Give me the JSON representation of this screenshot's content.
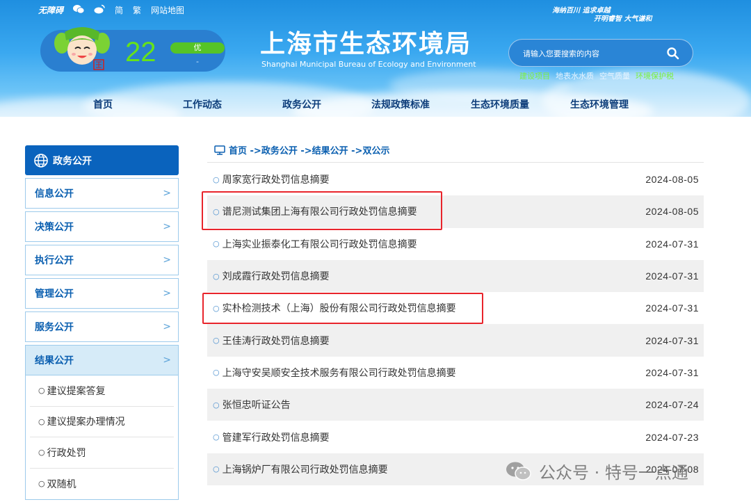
{
  "topbar": {
    "accessibility": "无障碍",
    "simplified": "简",
    "traditional": "繁",
    "sitemap": "网站地图"
  },
  "slogan": {
    "line1": "海纳百川  追求卓越",
    "line2": "开明睿智  大气谦和"
  },
  "aqi": {
    "value": "22",
    "level": "优",
    "sub": "-"
  },
  "site": {
    "title": "上海市生态环境局",
    "subtitle": "Shanghai Municipal Bureau of Ecology and Environment"
  },
  "search": {
    "placeholder": "请输入您要搜索的内容"
  },
  "quick_links": [
    "建设项目",
    "地表水水质",
    "空气质量",
    "环境保护税"
  ],
  "nav": [
    "首页",
    "工作动态",
    "政务公开",
    "法规政策标准",
    "生态环境质量",
    "生态环境管理"
  ],
  "sidebar": {
    "header": "政务公开",
    "items": [
      "信息公开",
      "决策公开",
      "执行公开",
      "管理公开",
      "服务公开",
      "结果公开"
    ],
    "sub_items": [
      "建议提案答复",
      "建议提案办理情况",
      "行政处罚",
      "双随机"
    ]
  },
  "breadcrumb": "首页 ->政务公开 ->结果公开 ->双公示",
  "list": [
    {
      "title": "周家宽行政处罚信息摘要",
      "date": "2024-08-05"
    },
    {
      "title": "谱尼测试集团上海有限公司行政处罚信息摘要",
      "date": "2024-08-05"
    },
    {
      "title": "上海实业振泰化工有限公司行政处罚信息摘要",
      "date": "2024-07-31"
    },
    {
      "title": "刘成霞行政处罚信息摘要",
      "date": "2024-07-31"
    },
    {
      "title": "实朴检测技术（上海）股份有限公司行政处罚信息摘要",
      "date": "2024-07-31"
    },
    {
      "title": "王佳涛行政处罚信息摘要",
      "date": "2024-07-31"
    },
    {
      "title": "上海守安吴顺安全技术服务有限公司行政处罚信息摘要",
      "date": "2024-07-31"
    },
    {
      "title": "张恒忠听证公告",
      "date": "2024-07-24"
    },
    {
      "title": "管建军行政处罚信息摘要",
      "date": "2024-07-23"
    },
    {
      "title": "上海锅炉厂有限公司行政处罚信息摘要",
      "date": "2024-07-08"
    }
  ],
  "watermark": "公众号 · 特号一点通",
  "colors": {
    "header_blue": "#1f8fe0",
    "sidebar_blue": "#0a63bd",
    "highlight_red": "#e8242b",
    "aqi_green": "#66e21a"
  }
}
